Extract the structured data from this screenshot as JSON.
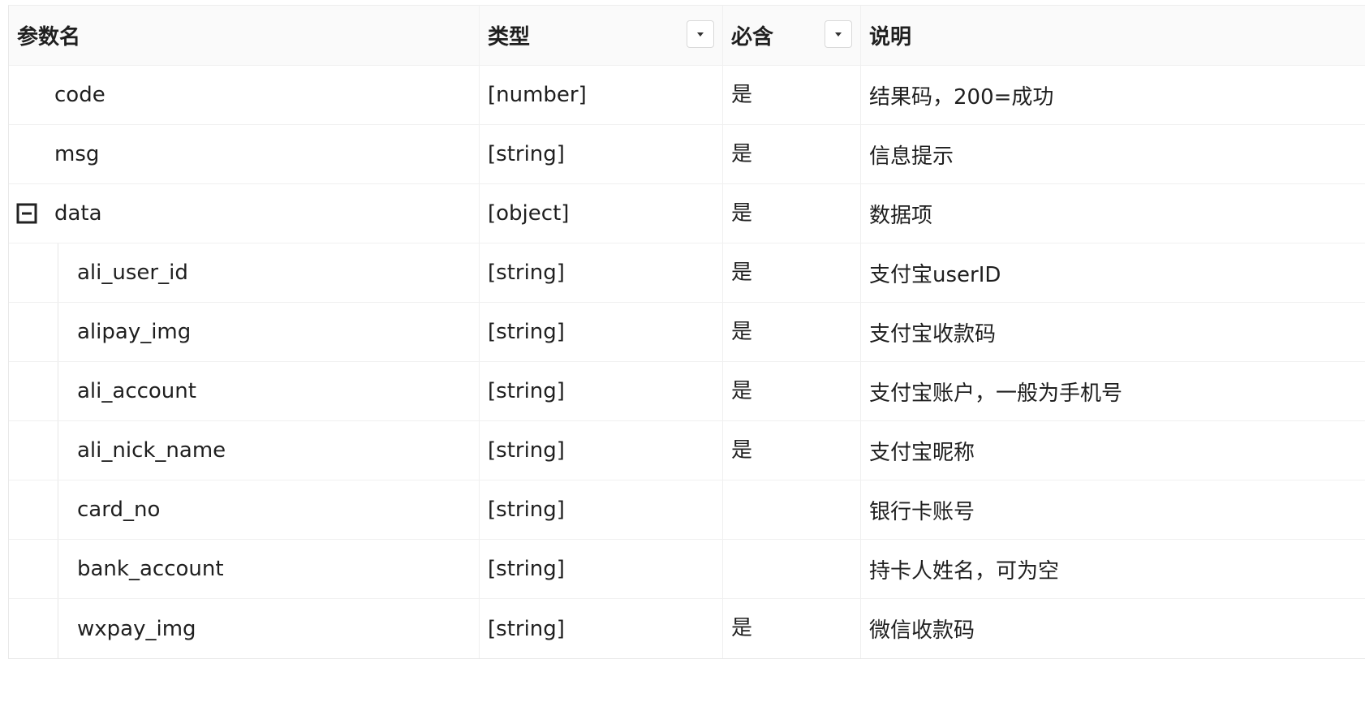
{
  "header": {
    "name": "参数名",
    "type": "类型",
    "required": "必含",
    "description": "说明"
  },
  "icons": {
    "type_filter": "caret-down-icon",
    "required_filter": "caret-down-icon",
    "collapse": "minus-square-icon"
  },
  "rows": [
    {
      "name": "code",
      "type": "[number]",
      "required": "是",
      "description": "结果码，200=成功"
    },
    {
      "name": "msg",
      "type": "[string]",
      "required": "是",
      "description": "信息提示"
    },
    {
      "name": "data",
      "type": "[object]",
      "required": "是",
      "description": "数据项"
    },
    {
      "name": "ali_user_id",
      "type": "[string]",
      "required": "是",
      "description": "支付宝userID"
    },
    {
      "name": "alipay_img",
      "type": "[string]",
      "required": "是",
      "description": "支付宝收款码"
    },
    {
      "name": "ali_account",
      "type": "[string]",
      "required": "是",
      "description": "支付宝账户，一般为手机号"
    },
    {
      "name": "ali_nick_name",
      "type": "[string]",
      "required": "是",
      "description": "支付宝昵称"
    },
    {
      "name": "card_no",
      "type": "[string]",
      "required": "",
      "description": "银行卡账号"
    },
    {
      "name": "bank_account",
      "type": "[string]",
      "required": "",
      "description": "持卡人姓名，可为空"
    },
    {
      "name": "wxpay_img",
      "type": "[string]",
      "required": "是",
      "description": "微信收款码"
    }
  ]
}
